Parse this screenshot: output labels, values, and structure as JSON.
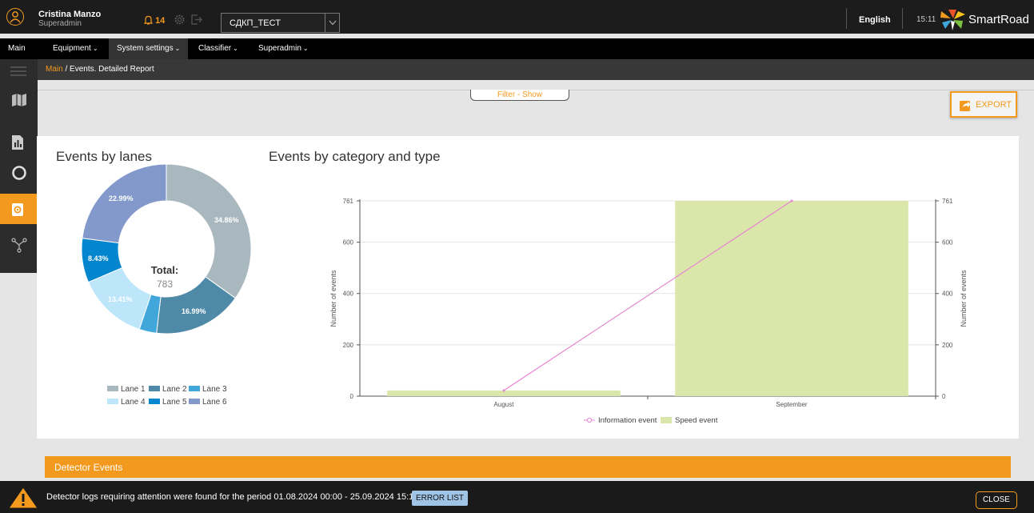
{
  "topbar": {
    "user_name": "Cristina Manzo",
    "user_role": "Superadmin",
    "notification_count": "14",
    "project_select": "СДКП_ТЕСТ",
    "language": "English",
    "time": "15:11",
    "brand": "SmartRoad"
  },
  "nav": {
    "items": [
      {
        "label": "Main"
      },
      {
        "label": "Equipment"
      },
      {
        "label": "System settings"
      },
      {
        "label": "Classifier"
      },
      {
        "label": "Superadmin"
      }
    ]
  },
  "breadcrumb": {
    "root": "Main",
    "sep": " / ",
    "current": "Events. Detailed Report"
  },
  "filter_tab": "Filter - Show",
  "export_label": "EXPORT",
  "donut": {
    "title": "Events by lanes",
    "total_label": "Total:",
    "total_value": "783",
    "labels": [
      "34.86%",
      "16.99%",
      "13.41%",
      "8.43%",
      "22.99%"
    ]
  },
  "bar_chart": {
    "title": "Events by category and type",
    "y_ticks": [
      "761",
      "600",
      "400",
      "200",
      "0"
    ],
    "legend": [
      "Information event",
      "Speed event"
    ]
  },
  "chart_data": [
    {
      "type": "pie",
      "title": "Events by lanes",
      "categories": [
        "Lane 1",
        "Lane 2",
        "Lane 3",
        "Lane 4",
        "Lane 5",
        "Lane 6"
      ],
      "values": [
        34.86,
        16.99,
        3.32,
        13.41,
        8.43,
        22.99
      ],
      "colors": [
        "#a9b8bf",
        "#4e8aa8",
        "#41a6d9",
        "#bde6fb",
        "#0386cd",
        "#8499cb"
      ],
      "total": 783,
      "legend_position": "bottom"
    },
    {
      "type": "bar",
      "title": "Events by category and type",
      "categories": [
        "August",
        "September"
      ],
      "ylabel": "Number of events",
      "ylim": [
        0,
        761
      ],
      "series": [
        {
          "name": "Speed event",
          "type": "bar",
          "values": [
            22,
            761
          ],
          "color": "#dbe6aa"
        },
        {
          "name": "Information event",
          "type": "line",
          "values": [
            22,
            761
          ],
          "color": "#e486d2"
        }
      ],
      "legend_position": "bottom"
    }
  ],
  "detector_events_label": "Detector Events",
  "notification": {
    "message": "Detector logs requiring attention were found for the period 01.08.2024 00:00 - 25.09.2024 15:11",
    "error_list_label": "ERROR LIST",
    "close_label": "CLOSE"
  },
  "colors": {
    "accent": "#f39a1e",
    "dark": "#1c1c1c"
  }
}
